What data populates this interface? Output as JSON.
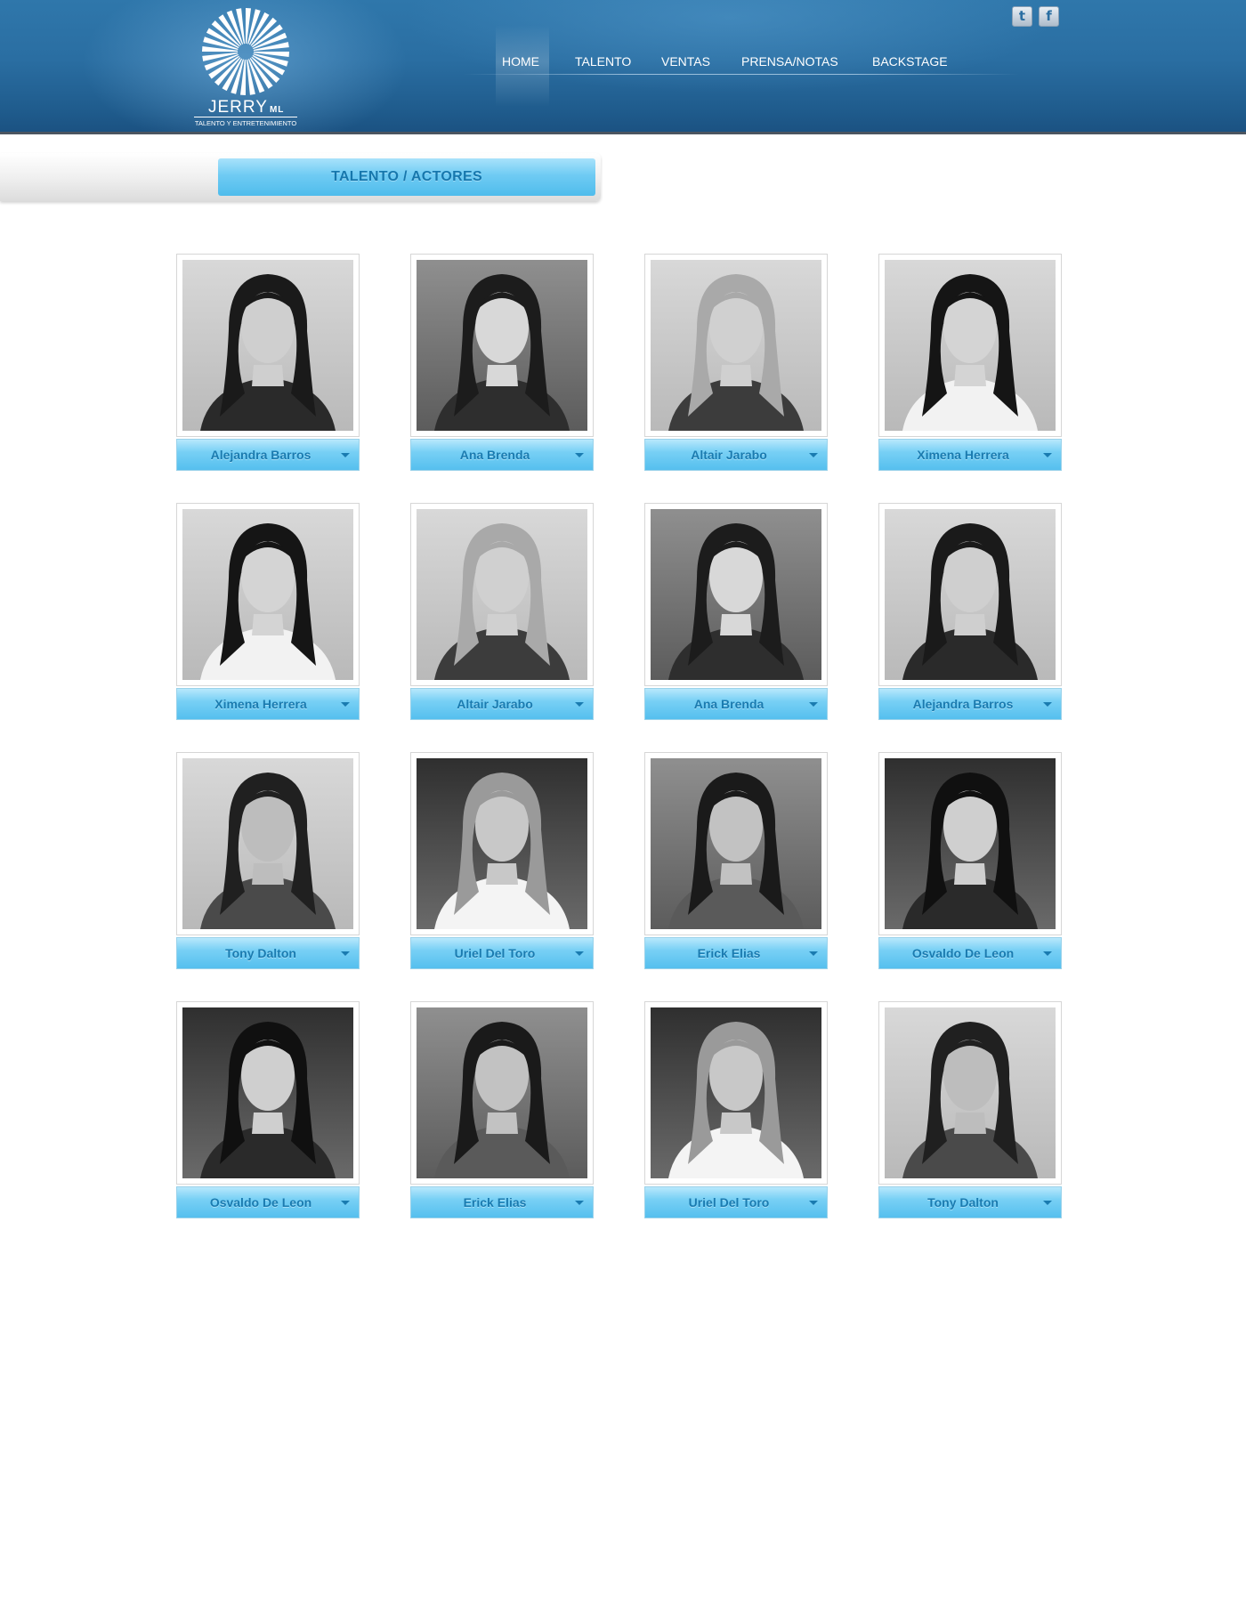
{
  "brand": {
    "name": "JERRY",
    "suffix": "ML",
    "tagline": "TALENTO Y ENTRETENIMIENTO"
  },
  "nav": {
    "items": [
      {
        "label": "HOME",
        "active": true
      },
      {
        "label": "TALENTO",
        "active": false
      },
      {
        "label": "VENTAS",
        "active": false
      },
      {
        "label": "PRENSA/NOTAS",
        "active": false
      },
      {
        "label": "BACKSTAGE",
        "active": false
      }
    ]
  },
  "social": {
    "twitter_glyph": "t",
    "facebook_glyph": "f",
    "icons": [
      "twitter-icon",
      "facebook-icon"
    ]
  },
  "section": {
    "title": "TALENTO / ACTORES"
  },
  "talent": [
    {
      "name": "Alejandra Barros",
      "photo": "woman-dark-hair"
    },
    {
      "name": "Ana Brenda",
      "photo": "woman-long-hair"
    },
    {
      "name": "Altair Jarabo",
      "photo": "woman-blonde"
    },
    {
      "name": "Ximena Herrera",
      "photo": "woman-dark-hair-pose"
    },
    {
      "name": "Ximena Herrera",
      "photo": "woman-dark-hair-pose"
    },
    {
      "name": "Altair Jarabo",
      "photo": "woman-blonde"
    },
    {
      "name": "Ana Brenda",
      "photo": "woman-long-hair"
    },
    {
      "name": "Alejandra Barros",
      "photo": "woman-dark-hair"
    },
    {
      "name": "Tony Dalton",
      "photo": "man-tshirt"
    },
    {
      "name": "Uriel Del Toro",
      "photo": "man-hat-scarf"
    },
    {
      "name": "Erick Elias",
      "photo": "man-blazer"
    },
    {
      "name": "Osvaldo De Leon",
      "photo": "man-vest"
    },
    {
      "name": "Osvaldo De Leon",
      "photo": "man-vest"
    },
    {
      "name": "Erick Elias",
      "photo": "man-blazer"
    },
    {
      "name": "Uriel Del Toro",
      "photo": "man-hat-scarf"
    },
    {
      "name": "Tony Dalton",
      "photo": "man-tshirt"
    }
  ],
  "colors": {
    "header": "#2a6ea2",
    "accent": "#6fcbf3",
    "label_text": "#1a7bb0"
  }
}
